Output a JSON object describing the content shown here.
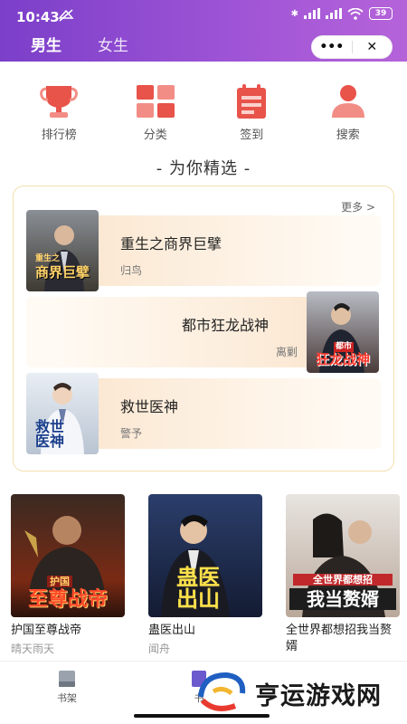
{
  "status": {
    "time": "10:43",
    "battery": "39"
  },
  "gender_tabs": [
    {
      "label": "男生",
      "active": true
    },
    {
      "label": "女生",
      "active": false
    }
  ],
  "capsule": {
    "more": "•••",
    "close": "✕"
  },
  "quick_nav": [
    {
      "label": "排行榜",
      "icon": "trophy-icon"
    },
    {
      "label": "分类",
      "icon": "grid-icon"
    },
    {
      "label": "签到",
      "icon": "calendar-icon"
    },
    {
      "label": "搜索",
      "icon": "person-search-icon"
    }
  ],
  "section_title": "- 为你精选 -",
  "featured": {
    "more_label": "更多 >",
    "items": [
      {
        "title": "重生之商界巨擘",
        "author": "归鸟",
        "cover_text": "商界巨擘",
        "cover_small": "重生之"
      },
      {
        "title": "都市狂龙战神",
        "author": "离剿",
        "cover_text": "狂龙战神",
        "cover_small": "都市"
      },
      {
        "title": "救世医神",
        "author": "警予",
        "cover_text": "救世医神"
      }
    ]
  },
  "books": [
    {
      "title": "护国至尊战帝",
      "author": "晴天雨天",
      "cover_text": "至尊战帝",
      "cover_small": "护国"
    },
    {
      "title": "蛊医出山",
      "author": "闻舟",
      "cover_text": "蛊医出山"
    },
    {
      "title": "全世界都想招我当赘婿",
      "author": "",
      "cover_text": "我当赘婿",
      "cover_small": "全世界都想招"
    }
  ],
  "tabbar": {
    "shelf": "书架",
    "store": "书"
  },
  "watermark": "亨运游戏网",
  "colors": {
    "accent": "#e8534a",
    "header_start": "#7b3fc9",
    "header_end": "#b563d9"
  }
}
